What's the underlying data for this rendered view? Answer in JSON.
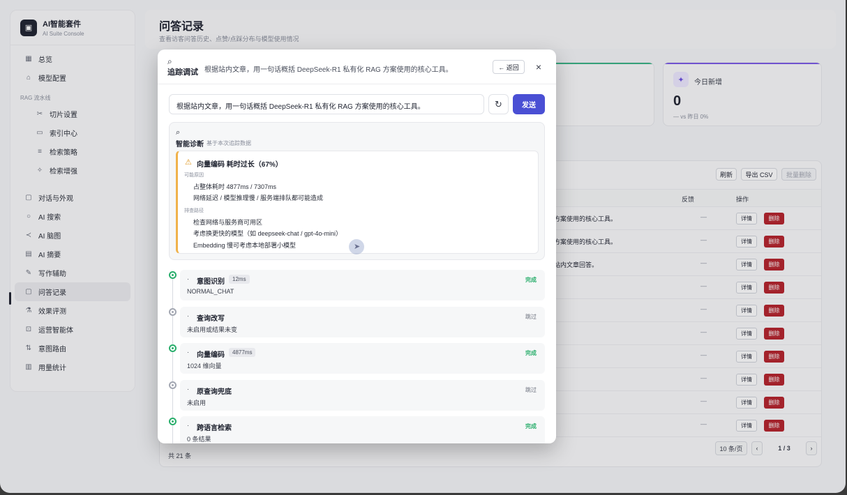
{
  "brand": {
    "title": "AI智能套件",
    "subtitle": "AI Suite Console"
  },
  "sidebar": {
    "items": [
      {
        "label": "总览",
        "icon": "grid-icon"
      },
      {
        "label": "模型配置",
        "icon": "box-icon"
      }
    ],
    "section_label": "RAG 流水线",
    "rag_items": [
      {
        "label": "切片设置",
        "icon": "scissors-icon"
      },
      {
        "label": "索引中心",
        "icon": "folder-icon"
      },
      {
        "label": "检索策略",
        "icon": "filter-icon"
      },
      {
        "label": "检索增强",
        "icon": "sparkle-icon"
      }
    ],
    "more_items": [
      {
        "label": "对话与外观",
        "icon": "chat-icon"
      },
      {
        "label": "AI 搜索",
        "icon": "search-icon"
      },
      {
        "label": "AI 脑图",
        "icon": "share-icon"
      },
      {
        "label": "AI 摘要",
        "icon": "doc-icon"
      },
      {
        "label": "写作辅助",
        "icon": "pen-icon"
      },
      {
        "label": "问答记录",
        "icon": "message-icon"
      },
      {
        "label": "效果评测",
        "icon": "flask-icon"
      },
      {
        "label": "运营智能体",
        "icon": "bot-icon"
      },
      {
        "label": "意图路由",
        "icon": "route-icon"
      },
      {
        "label": "用量统计",
        "icon": "bar-chart-icon"
      }
    ]
  },
  "page": {
    "title": "问答记录",
    "subtitle": "查看访客问答历史、点赞/点踩分布与模型使用情况"
  },
  "stat_today": {
    "label": "今日新增",
    "value": "0",
    "delta": "— vs 昨日 0%"
  },
  "table": {
    "buttons": {
      "refresh": "刷新",
      "export": "导出 CSV",
      "batch_delete": "批量删除"
    },
    "headers": {
      "feedback": "反馈",
      "actions": "操作"
    },
    "rows": [
      {
        "q": "方案使用的核心工具。",
        "fb": "—"
      },
      {
        "q": "方案使用的核心工具。",
        "fb": "—"
      },
      {
        "q": "站内文章回答。",
        "fb": "—"
      },
      {
        "q": "",
        "fb": "—"
      },
      {
        "q": "",
        "fb": "—"
      },
      {
        "q": "",
        "fb": "—"
      },
      {
        "q": "",
        "fb": "—"
      },
      {
        "q": "",
        "fb": "—"
      },
      {
        "q": "",
        "fb": "—"
      },
      {
        "q": "",
        "fb": "—"
      }
    ],
    "detail_label": "详情",
    "delete_label": "删除",
    "total": "共 21 条",
    "page_size": "10 条/页",
    "prev": "‹",
    "page_indicator": "1 / 3",
    "next": "›"
  },
  "modal": {
    "title": "追踪调试",
    "subtitle": "根据站内文章，用一句话概括 DeepSeek-R1 私有化 RAG 方案使用的核心工具。",
    "back_label": "← 返回",
    "close_label": "×",
    "query": "根据站内文章，用一句话概括 DeepSeek-R1 私有化 RAG 方案使用的核心工具。",
    "send_label": "发送",
    "diagnosis": {
      "title": "智能诊断",
      "subtitle": "基于本次追踪数据",
      "warning_title": "向量编码 耗时过长（67%）",
      "causes_label": "可能原因",
      "causes": [
        "占整体耗时 4877ms / 7307ms",
        "网络延迟 / 模型推理慢 / 服务端排队都可能造成"
      ],
      "paths_label": "排查路径",
      "paths": [
        "检查网络与服务商可用区",
        "考虑换更快的模型（如 deepseek-chat / gpt-4o-mini）",
        "Embedding 慢可考虑本地部署小模型"
      ]
    },
    "steps": [
      {
        "name": "意图识别",
        "time": "12ms",
        "status": "完成",
        "state": "done",
        "detail": "NORMAL_CHAT"
      },
      {
        "name": "查询改写",
        "time": "",
        "status": "跳过",
        "state": "skip",
        "detail": "未启用或结果未变"
      },
      {
        "name": "向量编码",
        "time": "4877ms",
        "status": "完成",
        "state": "done",
        "detail": "1024 维向量"
      },
      {
        "name": "原查询兜底",
        "time": "",
        "status": "跳过",
        "state": "skip",
        "detail": "未启用"
      },
      {
        "name": "跨语言检索",
        "time": "",
        "status": "完成",
        "state": "done",
        "detail": "0 条结果"
      }
    ]
  },
  "colors": {
    "accent": "#4a4fd4",
    "danger": "#b5232c",
    "success": "#2aae6c",
    "warning": "#f0b24a"
  }
}
